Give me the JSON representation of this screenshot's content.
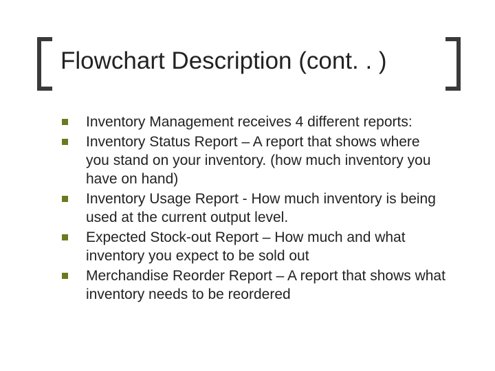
{
  "title": "Flowchart Description (cont. . )",
  "bullets": [
    {
      "text": "Inventory Management receives 4 different reports:"
    },
    {
      "text": "Inventory Status Report – A report that shows where you stand on your inventory. (how much inventory you have on hand)"
    },
    {
      "text": "Inventory Usage Report - How much inventory is being used at the current output level."
    },
    {
      "text": "Expected Stock-out Report – How much and what inventory you expect to be sold out"
    },
    {
      "text": "Merchandise Reorder Report – A report that shows what inventory needs to be reordered"
    }
  ]
}
